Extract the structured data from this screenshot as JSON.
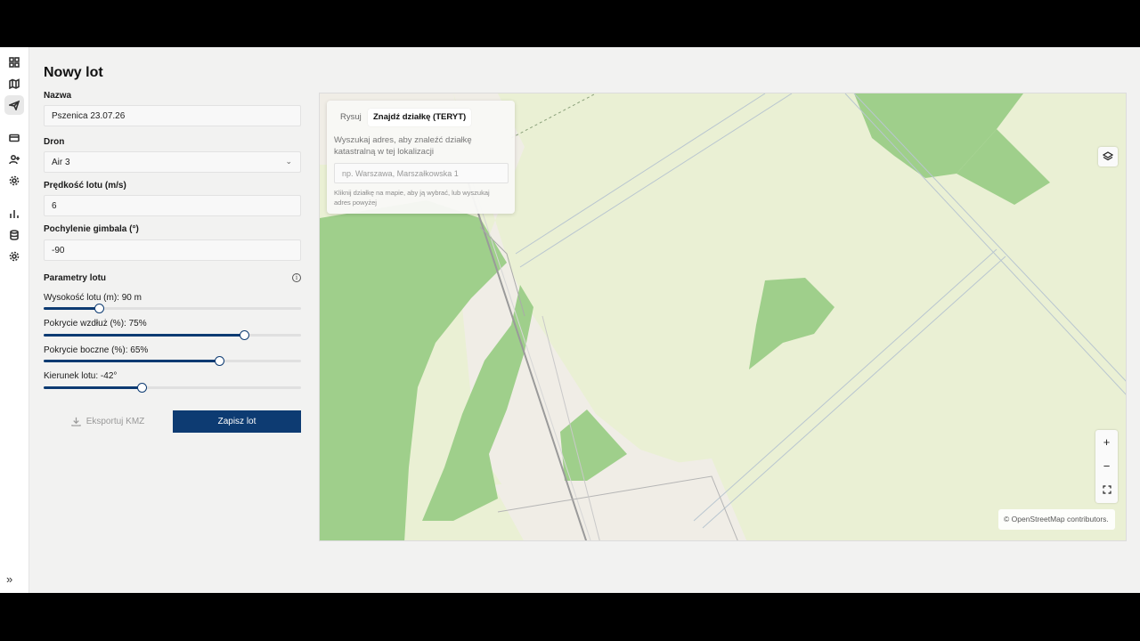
{
  "page": {
    "title": "Nowy lot"
  },
  "rail": {
    "icons": [
      "dashboard-icon",
      "map-icon",
      "plane-icon",
      "card-icon",
      "user-plus-icon",
      "settings-icon",
      "bar-chart-icon",
      "database-icon",
      "gear-icon"
    ],
    "active": "plane-icon",
    "expand_label": "»"
  },
  "form": {
    "name": {
      "label": "Nazwa",
      "value": "Pszenica 23.07.26"
    },
    "drone": {
      "label": "Dron",
      "value": "Air 3"
    },
    "speed": {
      "label": "Prędkość lotu (m/s)",
      "value": "6"
    },
    "gimbal": {
      "label": "Pochylenie gimbala (°)",
      "value": "-90"
    }
  },
  "flight_params": {
    "title": "Parametry lotu",
    "sliders": [
      {
        "label": "Wysokość lotu (m): 90 m",
        "fraction": 0.215
      },
      {
        "label": "Pokrycie wzdłuż (%): 75%",
        "fraction": 0.78
      },
      {
        "label": "Pokrycie boczne (%): 65%",
        "fraction": 0.68
      },
      {
        "label": "Kierunek lotu: -42°",
        "fraction": 0.38
      }
    ]
  },
  "actions": {
    "export_label": "Eksportuj KMZ",
    "save_label": "Zapisz lot"
  },
  "map": {
    "tabs": [
      "Rysuj",
      "Znajdź działkę (TERYT)"
    ],
    "active_tab": "Znajdź działkę (TERYT)",
    "search_description": "Wyszukaj adres, aby znaleźć działkę katastralną w tej lokalizacji",
    "search_placeholder": "np. Warszawa, Marszałkowska 1",
    "hint": "Kliknij działkę na mapie, aby ją wybrać, lub wyszukaj adres powyżej",
    "zoom_in": "+",
    "zoom_out": "−",
    "attribution": "© OpenStreetMap contributors."
  },
  "colors": {
    "accent": "#0d3b72",
    "forest": "#9fcf8b",
    "farmland": "#eaf0d4",
    "residential": "#f0ede6"
  }
}
